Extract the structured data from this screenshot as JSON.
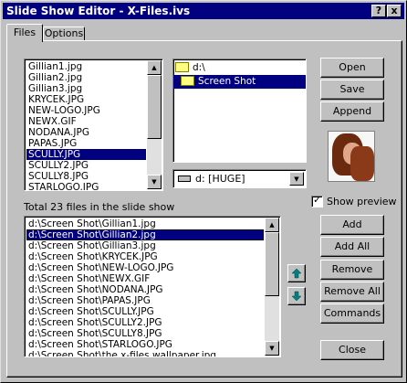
{
  "window": {
    "title": "Slide Show Editor - X-Files.ivs",
    "help_label": "?",
    "close_label": "x"
  },
  "tabs": [
    {
      "label": "Files"
    },
    {
      "label": "Options"
    }
  ],
  "source_files": [
    "Gillian1.jpg",
    "Gillian2.jpg",
    "Gillian3.jpg",
    "KRYCEK.JPG",
    "NEW-LOGO.JPG",
    "NEWX.GIF",
    "NODANA.JPG",
    "PAPAS.JPG",
    "SCULLY.JPG",
    "SCULLY2.JPG",
    "SCULLY8.JPG",
    "STARLOGO.JPG"
  ],
  "source_selected_index": 8,
  "folders": {
    "root": "d:\\",
    "current": "Screen Shot"
  },
  "drive": {
    "value": "d: [HUGE]"
  },
  "buttons_top": {
    "open": "Open",
    "save": "Save",
    "append": "Append"
  },
  "show_preview": {
    "label": "Show preview",
    "checked": true
  },
  "slide_count_text": "Total 23 files in the slide show",
  "slide_files": [
    "d:\\Screen Shot\\Gillian1.jpg",
    "d:\\Screen Shot\\Gillian2.jpg",
    "d:\\Screen Shot\\Gillian3.jpg",
    "d:\\Screen Shot\\KRYCEK.JPG",
    "d:\\Screen Shot\\NEW-LOGO.JPG",
    "d:\\Screen Shot\\NEWX.GIF",
    "d:\\Screen Shot\\NODANA.JPG",
    "d:\\Screen Shot\\PAPAS.JPG",
    "d:\\Screen Shot\\SCULLY.JPG",
    "d:\\Screen Shot\\SCULLY2.JPG",
    "d:\\Screen Shot\\SCULLY8.JPG",
    "d:\\Screen Shot\\STARLOGO.JPG",
    "d:\\Screen Shot\\the x-files wallpaper.jpg"
  ],
  "slide_selected_index": 1,
  "buttons_side": {
    "add": "Add",
    "add_all": "Add All",
    "remove": "Remove",
    "remove_all": "Remove All",
    "commands": "Commands",
    "close": "Close"
  },
  "icons": {
    "move_up": "up-arrow-icon",
    "move_down": "down-arrow-icon"
  },
  "colors": {
    "selection": "#000080",
    "move_arrow": "#008080"
  }
}
